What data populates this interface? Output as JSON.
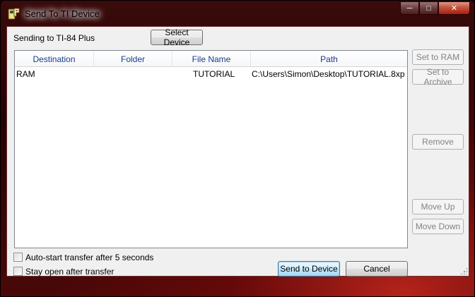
{
  "window": {
    "title": "Send To TI Device",
    "controls": {
      "minimize": "─",
      "maximize": "□",
      "close": "✕"
    }
  },
  "header": {
    "sending_to": "Sending to TI-84 Plus",
    "select_device_label": "Select Device"
  },
  "file_list": {
    "columns": [
      "Destination",
      "Folder",
      "File Name",
      "Path"
    ],
    "rows": [
      {
        "destination": "RAM",
        "folder": "",
        "file_name": "TUTORIAL",
        "path": "C:\\Users\\Simon\\Desktop\\TUTORIAL.8xp"
      }
    ]
  },
  "side_buttons": {
    "set_to_ram": "Set to RAM",
    "set_to_archive": "Set to Archive",
    "remove": "Remove",
    "move_up": "Move Up",
    "move_down": "Move Down"
  },
  "options": {
    "auto_start": {
      "label": "Auto-start transfer after 5 seconds",
      "checked": false
    },
    "stay_open": {
      "label": "Stay open after transfer",
      "checked": false
    }
  },
  "actions": {
    "send_label": "Send to Device",
    "cancel_label": "Cancel"
  }
}
